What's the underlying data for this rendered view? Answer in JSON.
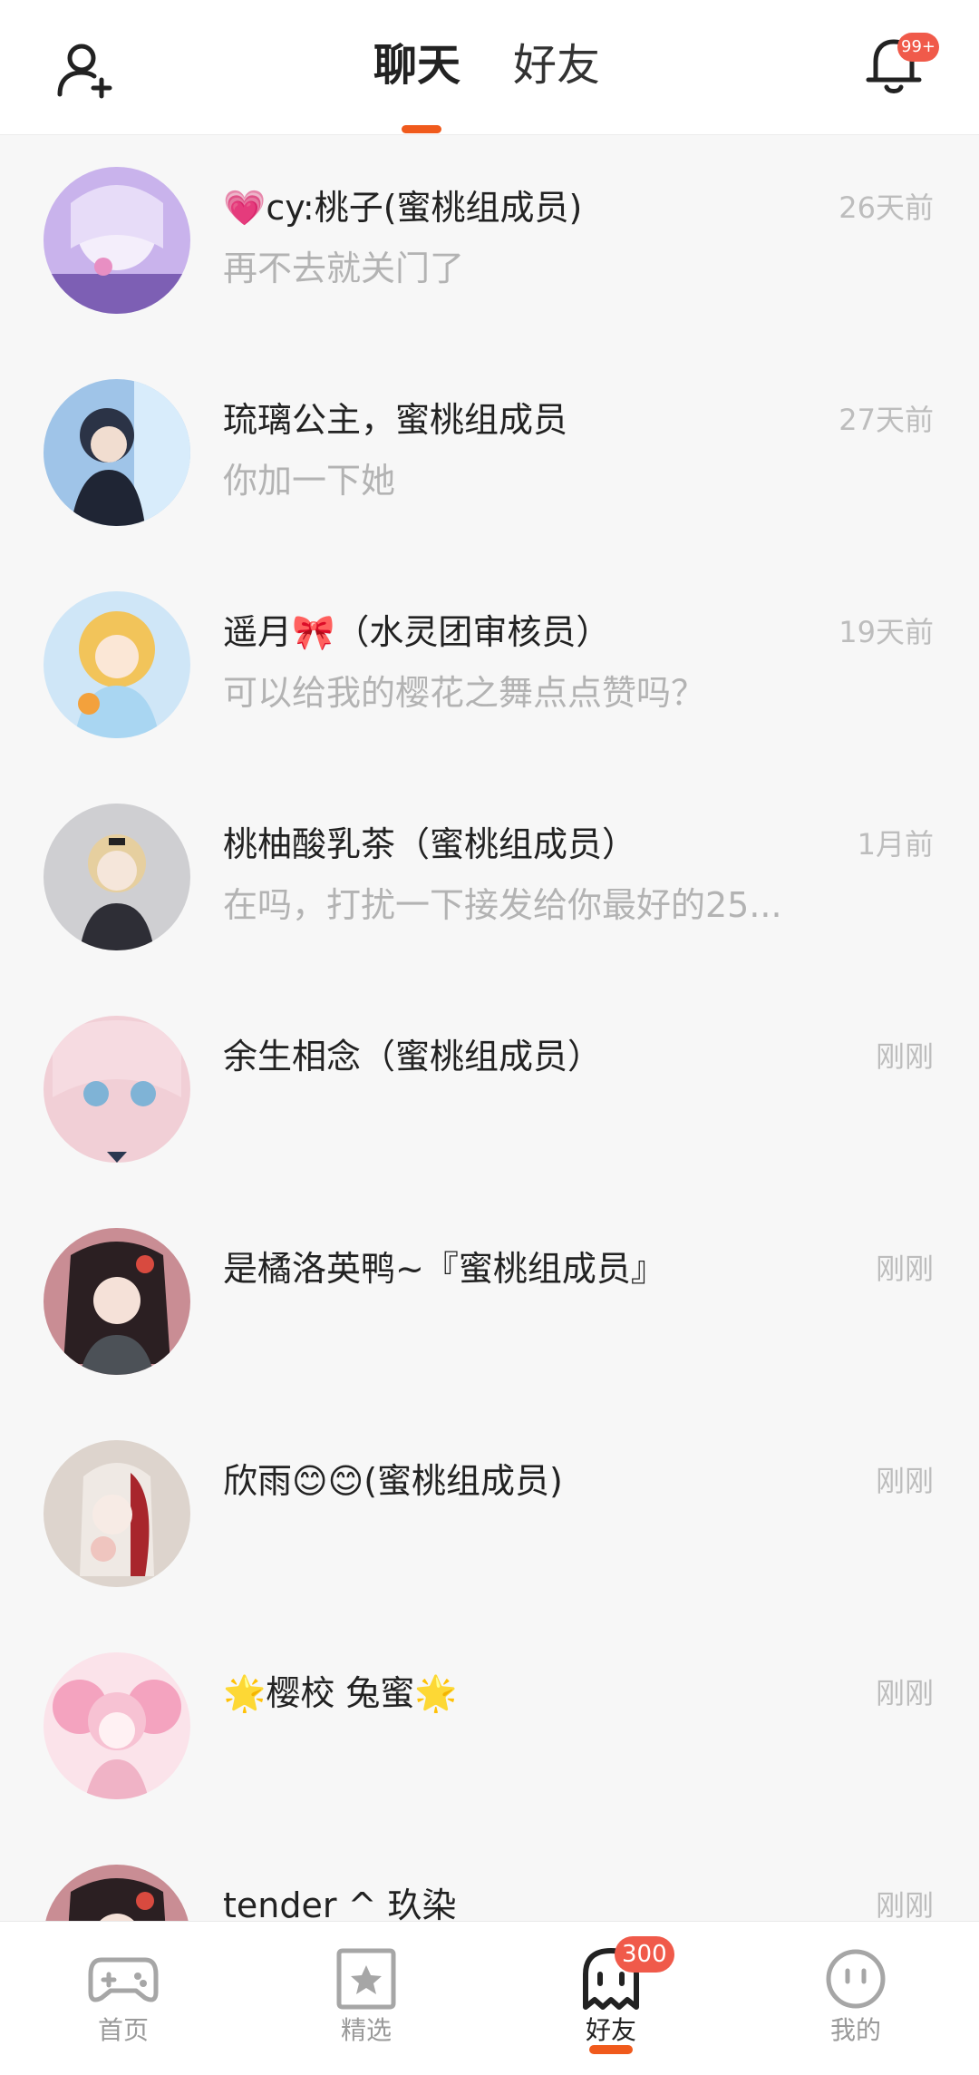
{
  "header": {
    "tabs": [
      {
        "label": "聊天",
        "active": true
      },
      {
        "label": "好友",
        "active": false
      }
    ],
    "notification_badge": "99+",
    "icons": {
      "left": "add-user-icon",
      "right": "bell-icon"
    }
  },
  "conversations": [
    {
      "name": "💗cy:桃子(蜜桃组成员)",
      "preview": "再不去就关门了",
      "time": "26天前"
    },
    {
      "name": "琉璃公主，蜜桃组成员",
      "preview": "你加一下她",
      "time": "27天前"
    },
    {
      "name": "遥月🎀（水灵团审核员）",
      "preview": "可以给我的樱花之舞点点赞吗？",
      "time": "19天前"
    },
    {
      "name": "桃柚酸乳茶（蜜桃组成员）",
      "preview": "在吗，打扰一下接发给你最好的25...",
      "time": "1月前"
    },
    {
      "name": "余生相念（蜜桃组成员）",
      "preview": "",
      "time": "刚刚"
    },
    {
      "name": "是橘洛英鸭~『蜜桃组成员』",
      "preview": "",
      "time": "刚刚"
    },
    {
      "name": "欣雨😊😊(蜜桃组成员)",
      "preview": "",
      "time": "刚刚"
    },
    {
      "name": "🌟樱校 兔蜜🌟",
      "preview": "",
      "time": "刚刚"
    },
    {
      "name": "tender ^ 玖染",
      "preview": "",
      "time": "刚刚"
    }
  ],
  "bottom_nav": {
    "items": [
      {
        "label": "首页",
        "icon": "gamepad-icon",
        "active": false
      },
      {
        "label": "精选",
        "icon": "star-bookmark-icon",
        "active": false
      },
      {
        "label": "好友",
        "icon": "ghost-icon",
        "active": true,
        "badge": "300"
      },
      {
        "label": "我的",
        "icon": "face-icon",
        "active": false
      }
    ]
  },
  "colors": {
    "accent": "#f05a1c",
    "badge": "#f05a4a",
    "background": "#f7f7f7"
  }
}
